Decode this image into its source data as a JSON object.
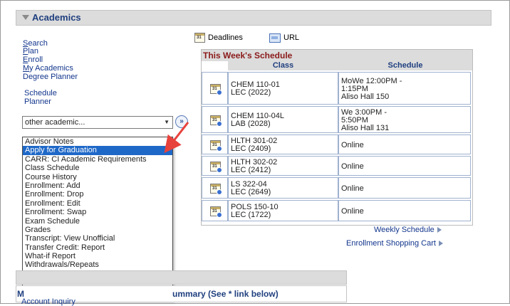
{
  "section": {
    "title": "Academics"
  },
  "left_links": [
    {
      "label": "Search"
    },
    {
      "label": "Plan"
    },
    {
      "label": "Enroll"
    },
    {
      "label": "My Academics"
    },
    {
      "label": "Degree Planner"
    },
    {
      "label": "Schedule"
    },
    {
      "label": "Planner"
    }
  ],
  "select": {
    "value": "other academic..."
  },
  "dropdown_items": [
    "Advisor Notes",
    "Apply for Graduation",
    "CARR: CI Academic Requirements",
    "Class Schedule",
    "Course History",
    "Enrollment: Add",
    "Enrollment: Drop",
    "Enrollment: Edit",
    "Enrollment: Swap",
    "Exam Schedule",
    "Grades",
    "Transcript: View Unofficial",
    "Transfer Credit: Report",
    "What-if Report",
    "Withdrawals/Repeats",
    "other academic..."
  ],
  "selected_index": 1,
  "toolbar": {
    "deadlines": "Deadlines",
    "url": "URL"
  },
  "schedule": {
    "title": "This Week's Schedule",
    "col_class": "Class",
    "col_schedule": "Schedule",
    "rows": [
      {
        "class1": "CHEM 110-01",
        "class2": "LEC (2022)",
        "sched": [
          "MoWe 12:00PM -",
          "1:15PM",
          "Aliso Hall 150"
        ]
      },
      {
        "class1": "CHEM 110-04L",
        "class2": "LAB (2028)",
        "sched": [
          "We 3:00PM -",
          "5:50PM",
          "Aliso Hall 131"
        ]
      },
      {
        "class1": "HLTH 301-02",
        "class2": "LEC (2409)",
        "sched": [
          "Online"
        ]
      },
      {
        "class1": "HLTH 302-02",
        "class2": "LEC (2412)",
        "sched": [
          "Online"
        ]
      },
      {
        "class1": "LS 322-04",
        "class2": "LEC (2649)",
        "sched": [
          "Online"
        ]
      },
      {
        "class1": "POLS 150-10",
        "class2": "LEC (1722)",
        "sched": [
          "Online"
        ]
      }
    ]
  },
  "links": {
    "weekly": "Weekly Schedule",
    "cart": "Enrollment Shopping Cart"
  },
  "bottom": {
    "summary": "ummary (See * link below)",
    "m": "M",
    "account": "Account Inquiry"
  },
  "colors": {
    "accent": "#1e68c8",
    "link": "#12358c",
    "arrow": "#e8423c"
  }
}
